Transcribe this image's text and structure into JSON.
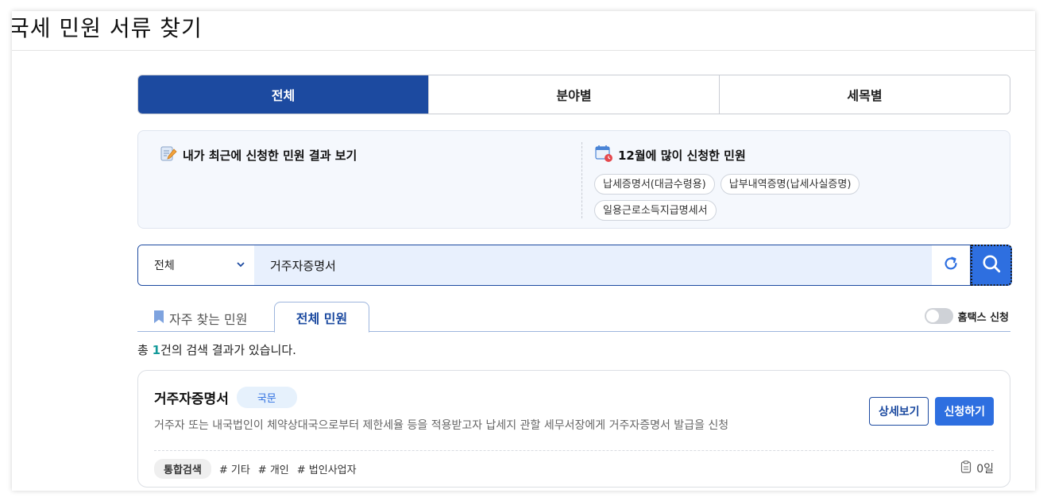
{
  "page": {
    "title": "국세 민원 서류 찾기"
  },
  "tabs": [
    {
      "label": "전체",
      "active": true
    },
    {
      "label": "분야별",
      "active": false
    },
    {
      "label": "세목별",
      "active": false
    }
  ],
  "recent": {
    "my_recent_label": "내가 최근에 신청한 민원 결과 보기",
    "popular_label": "12월에 많이 신청한 민원",
    "chips": [
      "납세증명서(대금수령용)",
      "납부내역증명(납세사실증명)",
      "일용근로소득지급명세서"
    ]
  },
  "search": {
    "category": "전체",
    "query": "거주자증명서"
  },
  "subtabs": {
    "favorites": "자주 찾는 민원",
    "all": "전체 민원",
    "hometax_toggle": "홈택스 신청"
  },
  "result_summary": {
    "prefix": "총 ",
    "count": "1",
    "suffix": "건의 검색 결과가 있습니다."
  },
  "results": [
    {
      "title": "거주자증명서",
      "badge": "국문",
      "description": "거주자 또는 내국법인이 체약상대국으로부터 제한세율 등을 적용받고자 납세지 관할 세무서장에게 거주자증명서 발급을 신청",
      "detail_label": "상세보기",
      "apply_label": "신청하기",
      "main_tag": "통합검색",
      "tags": [
        "# 기타",
        "# 개인",
        "# 법인사업자"
      ],
      "days": "0일"
    }
  ],
  "colors": {
    "primary": "#1c4aa0",
    "accent": "#2e6fe0",
    "count": "#149a9a"
  },
  "icons": {
    "my_recent": "memo-pencil-icon",
    "popular": "calendar-icon",
    "dropdown": "chevron-down-icon",
    "reset": "refresh-icon",
    "search": "search-icon",
    "favorites": "bookmark-icon",
    "days": "document-icon"
  }
}
